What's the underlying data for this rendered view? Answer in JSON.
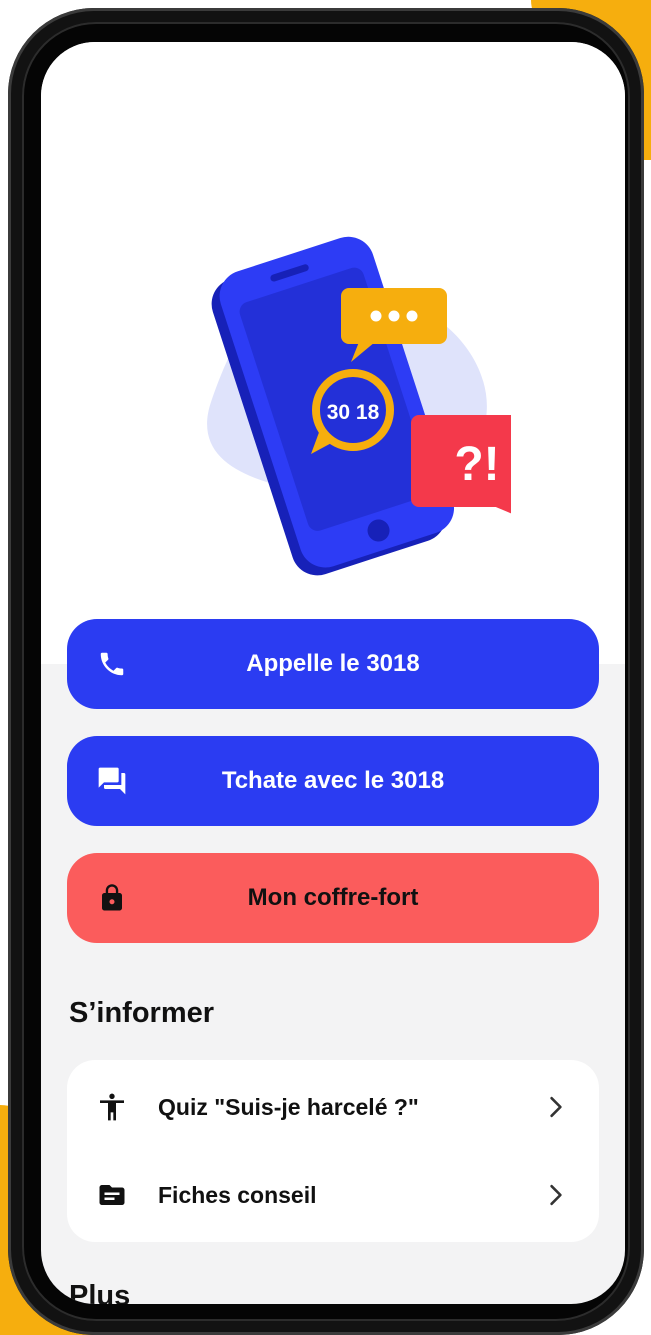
{
  "colors": {
    "primary_blue": "#2b3cf2",
    "coral": "#fb5c5c",
    "accent_yellow": "#f6ae0e",
    "background": "#f3f3f4"
  },
  "illustration": {
    "badge_text": "30 18",
    "bubble_text": "?!"
  },
  "actions": {
    "call": {
      "label": "Appelle le 3018",
      "icon": "phone-icon"
    },
    "chat": {
      "label": "Tchate avec le 3018",
      "icon": "chat-icon"
    },
    "safe": {
      "label": "Mon coffre-fort",
      "icon": "lock-icon"
    }
  },
  "inform": {
    "title": "S’informer",
    "items": [
      {
        "label": "Quiz \"Suis-je harcelé ?\"",
        "icon": "person-icon"
      },
      {
        "label": "Fiches conseil",
        "icon": "folder-icon"
      }
    ]
  },
  "next_section": {
    "title": "Plus"
  }
}
